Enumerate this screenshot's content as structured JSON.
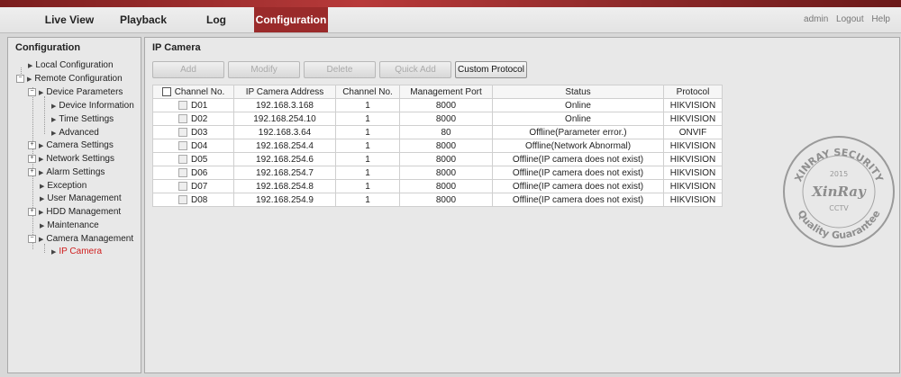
{
  "nav": {
    "tabs": [
      {
        "label": "Live View"
      },
      {
        "label": "Playback"
      },
      {
        "label": "Log"
      },
      {
        "label": "Configuration"
      }
    ],
    "user": "admin",
    "logout": "Logout",
    "help": "Help"
  },
  "sidebar": {
    "title": "Configuration",
    "items": [
      {
        "label": "Local Configuration"
      },
      {
        "label": "Remote Configuration"
      },
      {
        "label": "Device Parameters"
      },
      {
        "label": "Device Information"
      },
      {
        "label": "Time Settings"
      },
      {
        "label": "Advanced"
      },
      {
        "label": "Camera Settings"
      },
      {
        "label": "Network Settings"
      },
      {
        "label": "Alarm Settings"
      },
      {
        "label": "Exception"
      },
      {
        "label": "User Management"
      },
      {
        "label": "HDD Management"
      },
      {
        "label": "Maintenance"
      },
      {
        "label": "Camera Management"
      },
      {
        "label": "IP Camera"
      }
    ]
  },
  "main": {
    "title": "IP Camera",
    "toolbar": {
      "add": "Add",
      "modify": "Modify",
      "delete": "Delete",
      "quick_add": "Quick Add",
      "custom_protocol": "Custom Protocol"
    },
    "table": {
      "headers": [
        "Channel No.",
        "IP Camera Address",
        "Channel No.",
        "Management Port",
        "Status",
        "Protocol"
      ],
      "rows": [
        [
          "D01",
          "192.168.3.168",
          "1",
          "8000",
          "Online",
          "HIKVISION"
        ],
        [
          "D02",
          "192.168.254.10",
          "1",
          "8000",
          "Online",
          "HIKVISION"
        ],
        [
          "D03",
          "192.168.3.64",
          "1",
          "80",
          "Offline(Parameter error.)",
          "ONVIF"
        ],
        [
          "D04",
          "192.168.254.4",
          "1",
          "8000",
          "Offline(Network Abnormal)",
          "HIKVISION"
        ],
        [
          "D05",
          "192.168.254.6",
          "1",
          "8000",
          "Offline(IP camera does not exist)",
          "HIKVISION"
        ],
        [
          "D06",
          "192.168.254.7",
          "1",
          "8000",
          "Offline(IP camera does not exist)",
          "HIKVISION"
        ],
        [
          "D07",
          "192.168.254.8",
          "1",
          "8000",
          "Offline(IP camera does not exist)",
          "HIKVISION"
        ],
        [
          "D08",
          "192.168.254.9",
          "1",
          "8000",
          "Offline(IP camera does not exist)",
          "HIKVISION"
        ]
      ]
    }
  },
  "watermark": {
    "top": "XINRAY SECURITY",
    "year": "2015",
    "brand": "XinRay",
    "cctv": "CCTV",
    "bottom": "Quality Guarantee"
  },
  "colors": {
    "accent": "#9a2a2a",
    "selected_text": "#d02020"
  }
}
